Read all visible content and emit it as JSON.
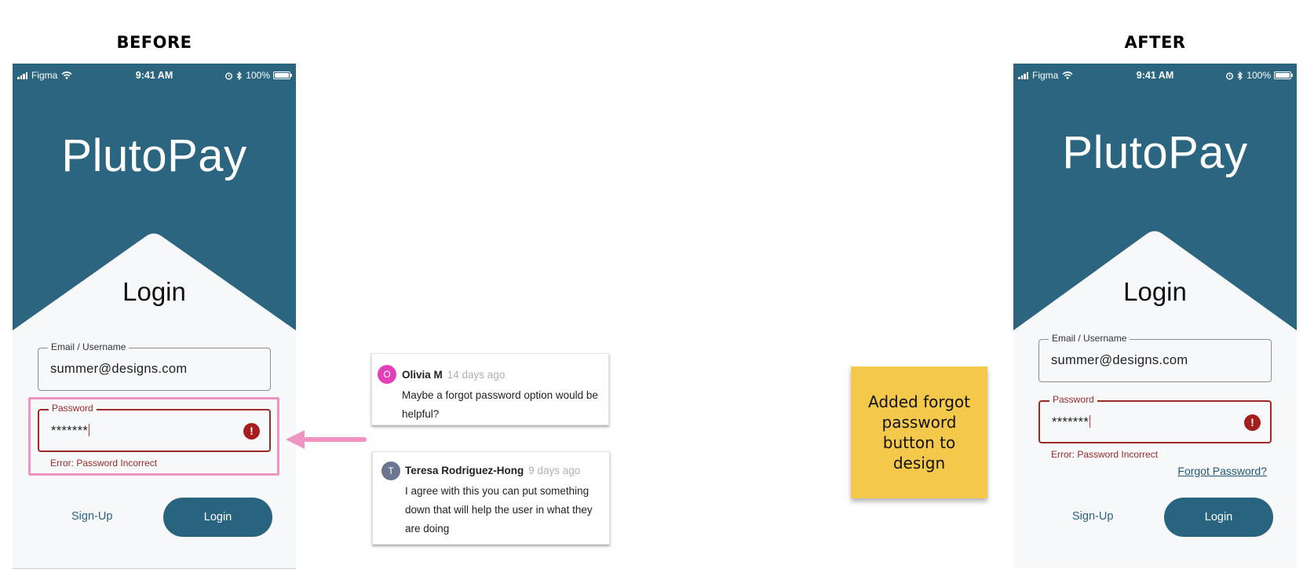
{
  "labels": {
    "before": "BEFORE",
    "after": "AFTER"
  },
  "colors": {
    "header_bg": "#2b6580",
    "screen_bg": "#f6f8fa",
    "button_bg": "#286480",
    "error": "#9c2a26",
    "highlight": "#ef93c2",
    "sticky_note": "#f4c84a"
  },
  "before_screen": {
    "status": {
      "carrier": "Figma",
      "time": "9:41 AM",
      "battery": "100%"
    },
    "app_name": "PlutoPay",
    "heading": "Login",
    "email": {
      "label": "Email / Username",
      "value": "summer@designs.com"
    },
    "password": {
      "label": "Password",
      "value": "*******",
      "error": "Error: Password Incorrect",
      "error_icon": "!"
    },
    "signup_label": "Sign-Up",
    "login_label": "Login"
  },
  "after_screen": {
    "status": {
      "carrier": "Figma",
      "time": "9:41 AM",
      "battery": "100%"
    },
    "app_name": "PlutoPay",
    "heading": "Login",
    "email": {
      "label": "Email / Username",
      "value": "summer@designs.com"
    },
    "password": {
      "label": "Password",
      "value": "*******",
      "error": "Error: Password Incorrect",
      "error_icon": "!"
    },
    "forgot_label": "Forgot Password?",
    "signup_label": "Sign-Up",
    "login_label": "Login"
  },
  "comments": [
    {
      "initial": "O",
      "author": "Olivia M",
      "date": "14 days ago",
      "text": "Maybe a forgot password option would be helpful?"
    },
    {
      "initial": "T",
      "author": "Teresa Rodriguez-Hong",
      "date": "9 days ago",
      "text": "I agree with this you can put something down that will help the user in what they are doing"
    }
  ],
  "sticky_note": "Added forgot password button to design"
}
